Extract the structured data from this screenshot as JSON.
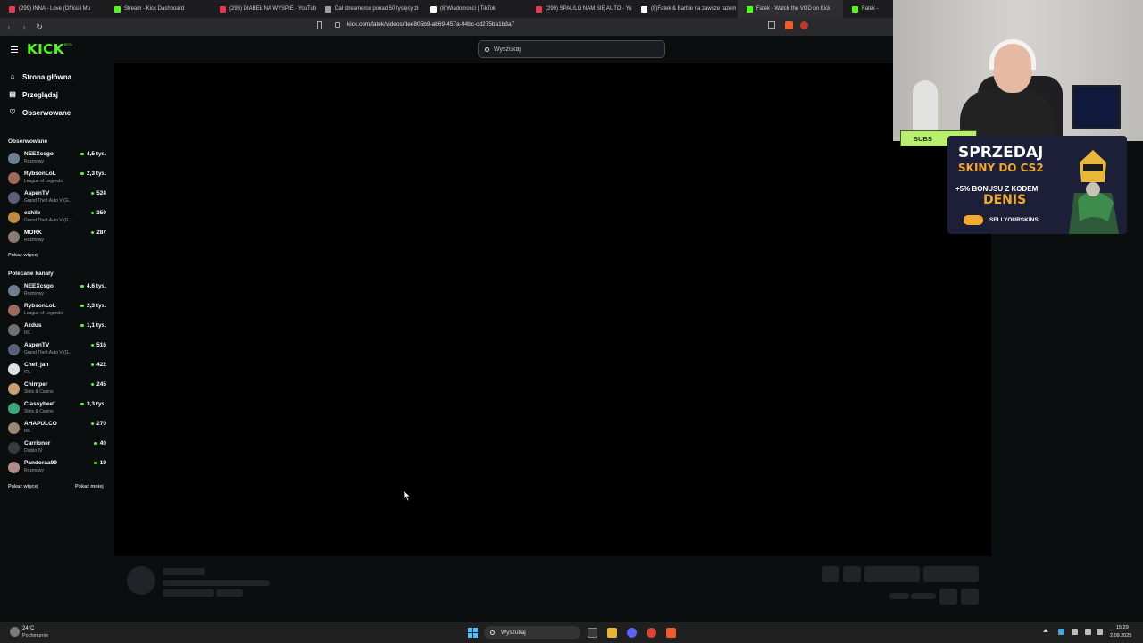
{
  "browser": {
    "tabs": [
      {
        "label": "(299) INNA - Love (Official Mu",
        "icon": "youtube-icon",
        "color": "#e8384f"
      },
      {
        "label": "Stream - Kick Dashboard",
        "icon": "kick-icon",
        "color": "#53fc18"
      },
      {
        "label": "(296) DIABEŁ NA WYSPIE - YouTub",
        "icon": "youtube-icon",
        "color": "#e8384f"
      },
      {
        "label": "Dał streamerce ponad 50 tysięcy zł",
        "icon": "bookmark-icon",
        "color": "#9aa0a6"
      },
      {
        "label": "(8)Wiadomości | TikTok",
        "icon": "tiktok-icon",
        "color": "#ffffff"
      },
      {
        "label": "(299) SPAŁ/LO NAM SIĘ AUTO - Yo",
        "icon": "youtube-icon",
        "color": "#e8384f"
      },
      {
        "label": "(8)Fatek & Barbie na zawsze razem",
        "icon": "tiktok-icon",
        "color": "#ffffff"
      },
      {
        "label": "Fatek - Watch the VOD on Kick",
        "icon": "kick-icon",
        "color": "#53fc18"
      },
      {
        "label": "Fatek - Watch",
        "icon": "kick-icon",
        "color": "#53fc18"
      }
    ],
    "url": "kick.com/fatek/videos/dee805b9-ab69-457a-94bc-cd275ba1b3a7"
  },
  "header": {
    "logo": "KICK",
    "logo_badge": "BETA",
    "search_placeholder": "Wyszukaj"
  },
  "sidebar": {
    "nav": [
      {
        "label": "Strona główna",
        "icon": "home-icon"
      },
      {
        "label": "Przeglądaj",
        "icon": "browse-icon"
      },
      {
        "label": "Obserwowane",
        "icon": "heart-icon"
      }
    ],
    "followed_title": "Obserwowane",
    "followed": [
      {
        "name": "NEEXcsgo",
        "category": "Rozmowy",
        "viewers": "4,5 tys.",
        "avatar_color": "#6d7f8f"
      },
      {
        "name": "RybsonLoL",
        "category": "League of Legends",
        "viewers": "2,3 tys.",
        "avatar_color": "#a06a5a"
      },
      {
        "name": "AspenTV",
        "category": "Grand Theft Auto V (G...",
        "viewers": "524",
        "avatar_color": "#5a5f7a"
      },
      {
        "name": "exhile",
        "category": "Grand Theft Auto V (G...",
        "viewers": "359",
        "avatar_color": "#c08a40"
      },
      {
        "name": "MORK",
        "category": "Rozmowy",
        "viewers": "287",
        "avatar_color": "#8a7a70"
      }
    ],
    "followed_more": "Pokaż więcej",
    "recommended_title": "Polecane kanały",
    "recommended": [
      {
        "name": "NEEXcsgo",
        "category": "Rozmowy",
        "viewers": "4,6 tys.",
        "avatar_color": "#6d7f8f"
      },
      {
        "name": "RybsonLoL",
        "category": "League of Legends",
        "viewers": "2,3 tys.",
        "avatar_color": "#a06a5a"
      },
      {
        "name": "Azdus",
        "category": "IRL",
        "viewers": "1,1 tys.",
        "avatar_color": "#707070"
      },
      {
        "name": "AspenTV",
        "category": "Grand Theft Auto V (G...",
        "viewers": "516",
        "avatar_color": "#5a5f7a"
      },
      {
        "name": "Chef_jan",
        "category": "IRL",
        "viewers": "422",
        "avatar_color": "#e0e0e0"
      },
      {
        "name": "Chimper",
        "category": "Slots & Casino",
        "viewers": "245",
        "avatar_color": "#c9a070"
      },
      {
        "name": "Classybeef",
        "category": "Slots & Casino",
        "viewers": "3,3 tys.",
        "avatar_color": "#3aa57a"
      },
      {
        "name": "AHAPULCO",
        "category": "IRL",
        "viewers": "270",
        "avatar_color": "#9a8a70"
      },
      {
        "name": "Carrioner",
        "category": "Diablo IV",
        "viewers": "40",
        "avatar_color": "#3a3a3a"
      },
      {
        "name": "Pandoraa99",
        "category": "Rozmowy",
        "viewers": "19",
        "avatar_color": "#b08a8a"
      }
    ],
    "recommended_more": "Pokaż więcej",
    "recommended_less": "Pokaż mniej"
  },
  "overlay": {
    "subs_label": "SUBS",
    "promo_line1": "SPRZEDAJ",
    "promo_line2": "SKINY DO CS2",
    "promo_line3": "+5% BONUSU Z KODEM",
    "promo_code": "DENIS",
    "promo_brand": "SELLYOURSKINS"
  },
  "taskbar": {
    "weather_temp": "24°C",
    "weather_desc": "Pochmurnie",
    "search_label": "Wyszukaj",
    "time": "15:29",
    "date": "2.09.2025"
  }
}
